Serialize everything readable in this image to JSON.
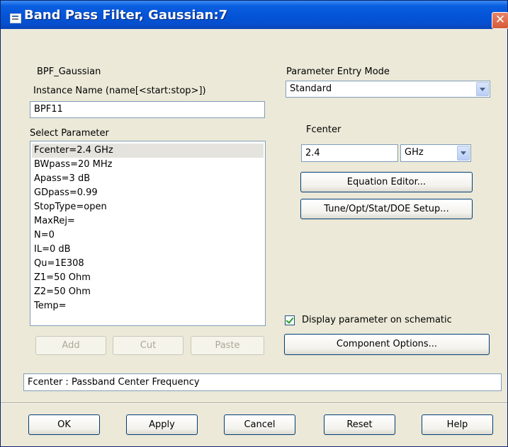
{
  "window": {
    "title": "Band Pass Filter, Gaussian:7",
    "close_glyph": "✕"
  },
  "component": {
    "type_label": "BPF_Gaussian"
  },
  "instance": {
    "label": "Instance Name  (name[<start:stop>])",
    "value": "BPF11"
  },
  "entry_mode": {
    "label": "Parameter Entry Mode",
    "value": "Standard"
  },
  "param_list": {
    "label": "Select Parameter",
    "items": [
      "Fcenter=2.4 GHz",
      "BWpass=20 MHz",
      "Apass=3 dB",
      "GDpass=0.99",
      "StopType=open",
      "MaxRej=",
      "N=0",
      "IL=0 dB",
      "Qu=1E308",
      "Z1=50 Ohm",
      "Z2=50 Ohm",
      "Temp="
    ],
    "selected_index": 0
  },
  "param_edit": {
    "name": "Fcenter",
    "value": "2.4",
    "unit": "GHz"
  },
  "buttons": {
    "equation_editor": "Equation Editor...",
    "tune_setup": "Tune/Opt/Stat/DOE Setup...",
    "add": "Add",
    "cut": "Cut",
    "paste": "Paste",
    "component_options": "Component Options...",
    "ok": "OK",
    "apply": "Apply",
    "cancel": "Cancel",
    "reset": "Reset",
    "help": "Help"
  },
  "display_on_schematic": {
    "label": "Display parameter on schematic",
    "checked": true
  },
  "description": "Fcenter : Passband Center Frequency"
}
